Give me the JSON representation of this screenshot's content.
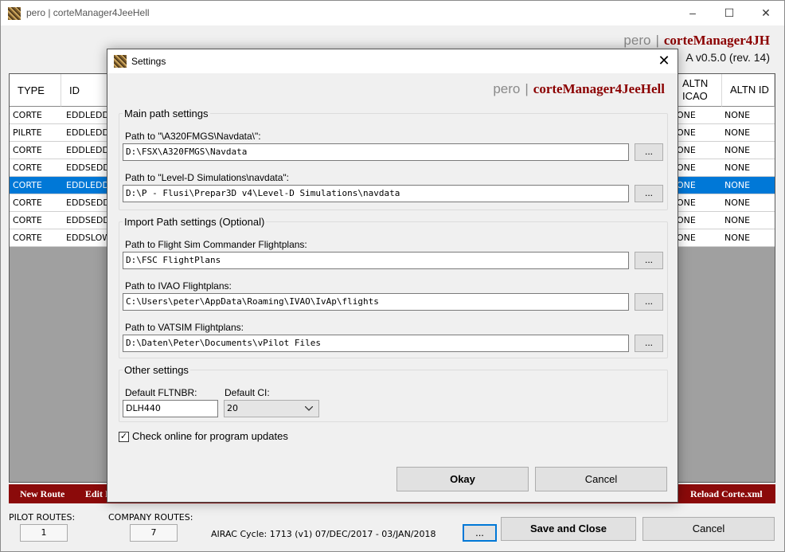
{
  "window": {
    "title": "pero | corteManager4JeeHell",
    "brand_pero": "pero",
    "brand_sep": "|",
    "brand_name": "corteManager4JH",
    "version": "A v0.5.0 (rev. 14)",
    "controls": [
      "–",
      "☐",
      "✕"
    ]
  },
  "grid": {
    "headers": {
      "type": "TYPE",
      "id": "ID",
      "altn_icao": "ALTN ICAO",
      "altn_id": "ALTN ID"
    },
    "rows": [
      {
        "type": "CORTE",
        "id": "EDDLEDDI",
        "altn_icao": "ONE",
        "altn_id": "NONE"
      },
      {
        "type": "PILRTE",
        "id": "EDDLEDDF",
        "altn_icao": "ONE",
        "altn_id": "NONE"
      },
      {
        "type": "CORTE",
        "id": "EDDLEDDH",
        "altn_icao": "ONE",
        "altn_id": "NONE"
      },
      {
        "type": "CORTE",
        "id": "EDDSEDDF",
        "altn_icao": "ONE",
        "altn_id": "NONE"
      },
      {
        "type": "CORTE",
        "id": "EDDLEDDS",
        "altn_icao": "ONE",
        "altn_id": "NONE"
      },
      {
        "type": "CORTE",
        "id": "EDDSEDDI",
        "altn_icao": "ONE",
        "altn_id": "NONE"
      },
      {
        "type": "CORTE",
        "id": "EDDSEDDF",
        "altn_icao": "ONE",
        "altn_id": "NONE"
      },
      {
        "type": "CORTE",
        "id": "EDDSLOWI",
        "altn_icao": "ONE",
        "altn_id": "NONE"
      }
    ],
    "selected_index": 4
  },
  "actions": {
    "new_route": "New Route",
    "edit": "Edit I",
    "reload": "Reload Corte.xml"
  },
  "footer": {
    "pilot_routes_label": "PILOT ROUTES:",
    "pilot_routes_value": "1",
    "company_routes_label": "COMPANY ROUTES:",
    "company_routes_value": "7",
    "airac": "AIRAC Cycle: 1713 (v1) 07/DEC/2017 - 03/JAN/2018",
    "airac_browse": "...",
    "save_close": "Save and Close",
    "cancel": "Cancel"
  },
  "dialog": {
    "title": "Settings",
    "close": "✕",
    "brand_pero": "pero",
    "brand_sep": "|",
    "brand_name": "corteManager4JeeHell",
    "main_group": "Main path settings",
    "fmgs_label": "Path to \"\\A320FMGS\\Navdata\\\":",
    "fmgs_value": "D:\\FSX\\A320FMGS\\Navdata",
    "leveld_label": "Path to \"Level-D Simulations\\navdata\":",
    "leveld_value": "D:\\P - Flusi\\Prepar3D v4\\Level-D Simulations\\navdata",
    "import_group": "Import Path settings (Optional)",
    "fsc_label": "Path to Flight Sim Commander Flightplans:",
    "fsc_value": "D:\\FSC FlightPlans",
    "ivao_label": "Path to IVAO Flightplans:",
    "ivao_value": "C:\\Users\\peter\\AppData\\Roaming\\IVAO\\IvAp\\flights",
    "vatsim_label": "Path to VATSIM Flightplans:",
    "vatsim_value": "D:\\Daten\\Peter\\Documents\\vPilot Files",
    "browse": "...",
    "other_group": "Other settings",
    "fltnbr_label": "Default FLTNBR:",
    "fltnbr_value": "DLH440",
    "ci_label": "Default CI:",
    "ci_value": "20",
    "check_updates": "Check online for program updates",
    "check_mark": "✓",
    "okay": "Okay",
    "cancel": "Cancel"
  },
  "colors": {
    "accent": "#8b0000",
    "selection": "#0078d7",
    "action_bar": "#8b0a0a"
  }
}
